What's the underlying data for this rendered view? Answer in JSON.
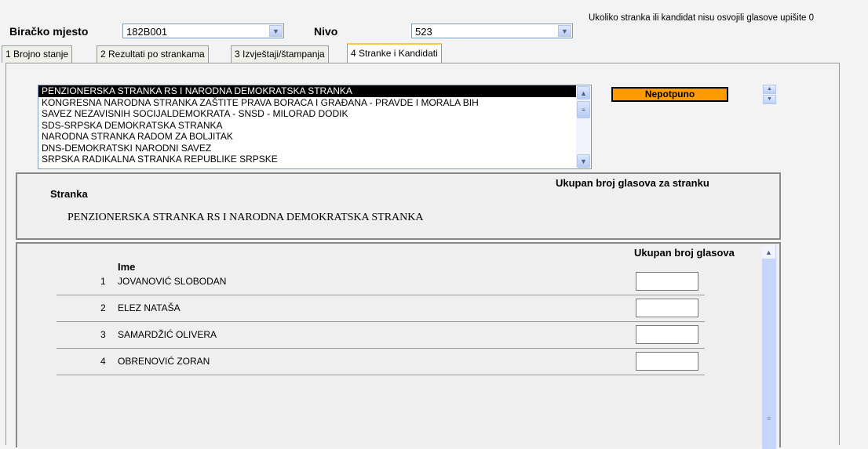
{
  "header": {
    "polling_station_label": "Biračko mjesto",
    "polling_station_value": "182B001",
    "level_label": "Nivo",
    "level_value": "523",
    "note": "Ukoliko stranka ili kandidat nisu osvojili glasove upišite 0"
  },
  "tabs": [
    {
      "label": "1 Brojno stanje"
    },
    {
      "label": "2 Rezultati po strankama"
    },
    {
      "label": "3 Izvještaji/štampanja"
    },
    {
      "label": "4 Stranke i Kandidati",
      "active": true
    }
  ],
  "party_list": {
    "items": [
      "PENZIONERSKA STRANKA RS I NARODNA DEMOKRATSKA STRANKA",
      "KONGRESNA NARODNA STRANKA ZAŠTITE PRAVA BORACA I GRAĐANA - PRAVDE I MORALA BIH",
      "SAVEZ NEZAVISNIH SOCIJALDEMOKRATA - SNSD - MILORAD DODIK",
      "SDS-SRPSKA DEMOKRATSKA STRANKA",
      "NARODNA STRANKA RADOM ZA BOLJITAK",
      "DNS-DEMOKRATSKI NARODNI SAVEZ",
      "SRPSKA RADIKALNA STRANKA REPUBLIKE SRPSKE"
    ],
    "selected_index": 0
  },
  "status": {
    "label": "Nepotpuno",
    "color": "#ff9a00"
  },
  "party_box": {
    "party_header": "Stranka",
    "total_header": "Ukupan broj glasova za stranku",
    "party_name": "PENZIONERSKA STRANKA RS I NARODNA DEMOKRATSKA STRANKA"
  },
  "candidates": {
    "name_header": "Ime",
    "votes_header": "Ukupan broj glasova",
    "rows": [
      {
        "num": "1",
        "name": "JOVANOVIĆ SLOBODAN",
        "votes": ""
      },
      {
        "num": "2",
        "name": "ELEZ NATAŠA",
        "votes": ""
      },
      {
        "num": "3",
        "name": "SAMARDŽIĆ OLIVERA",
        "votes": ""
      },
      {
        "num": "4",
        "name": "OBRENOVIĆ ZORAN",
        "votes": ""
      }
    ]
  }
}
